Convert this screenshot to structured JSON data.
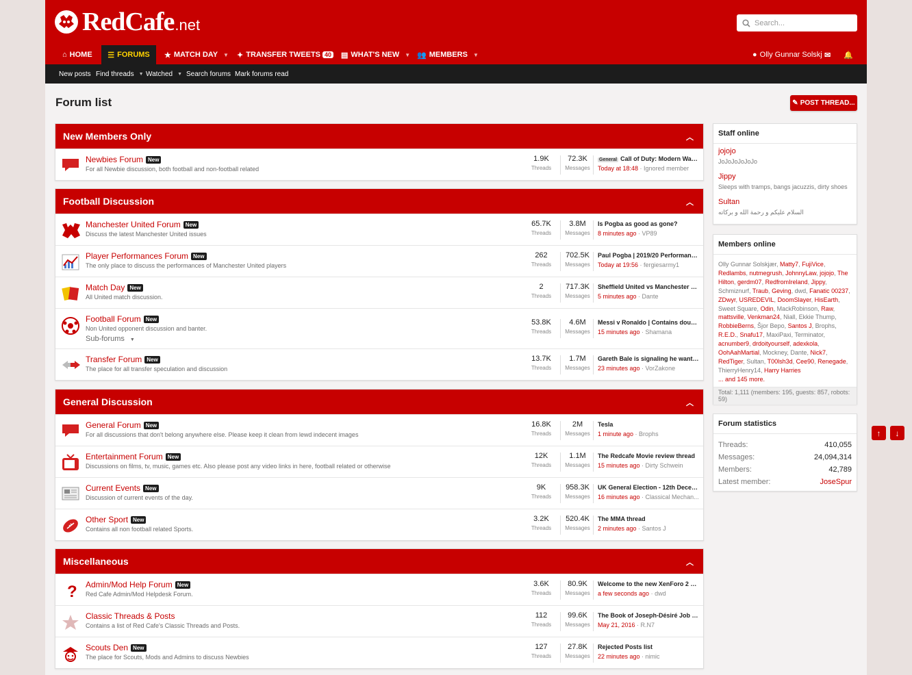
{
  "header": {
    "logo_text": "RedCafe",
    "logo_tld": ".net",
    "search_placeholder": "Search..."
  },
  "nav": {
    "home": "HOME",
    "forums": "FORUMS",
    "match_day": "MATCH DAY",
    "transfer_tweets": "TRANSFER TWEETS",
    "transfer_count": "40",
    "whats_new": "WHAT'S NEW",
    "members": "MEMBERS",
    "user": "Olly Gunnar Solskj"
  },
  "subnav": {
    "new_posts": "New posts",
    "find_threads": "Find threads",
    "watched": "Watched",
    "search_forums": "Search forums",
    "mark_read": "Mark forums read"
  },
  "page": {
    "title": "Forum list",
    "post_thread": "POST THREAD..."
  },
  "labels": {
    "threads": "Threads",
    "messages": "Messages",
    "new": "New",
    "subforums": "Sub-forums"
  },
  "categories": [
    {
      "title": "New Members Only",
      "nodes": [
        {
          "title": "Newbies Forum",
          "new": true,
          "desc": "For all Newbie discussion, both football and non-football related",
          "threads": "1.9K",
          "messages": "72.3K",
          "prefix": "General",
          "last_title": "Call of Duty: Modern Ware...",
          "last_time": "Today at 18:48",
          "last_user": "Ignored member"
        }
      ]
    },
    {
      "title": "Football Discussion",
      "nodes": [
        {
          "title": "Manchester United Forum",
          "new": true,
          "desc": "Discuss the latest Manchester United issues",
          "threads": "65.7K",
          "messages": "3.8M",
          "last_title": "Is Pogba as good as gone?",
          "last_time": "8 minutes ago",
          "last_user": "VP89"
        },
        {
          "title": "Player Performances Forum",
          "new": true,
          "desc": "The only place to discuss the performances of Manchester United players",
          "threads": "262",
          "messages": "702.5K",
          "last_title": "Paul Pogba | 2019/20 Performanc...",
          "last_time": "Today at 19:56",
          "last_user": "fergiesarmy1"
        },
        {
          "title": "Match Day",
          "new": true,
          "desc": "All United match discussion.",
          "threads": "2",
          "messages": "717.3K",
          "last_title": "Sheffield United vs Manchester Un...",
          "last_time": "5 minutes ago",
          "last_user": "Dante"
        },
        {
          "title": "Football Forum",
          "new": true,
          "desc": "Non United opponent discussion and banter.",
          "threads": "53.8K",
          "messages": "4.6M",
          "last_title": "Messi v Ronaldo | Contains double...",
          "last_time": "15 minutes ago",
          "last_user": "Shamana"
        },
        {
          "title": "Transfer Forum",
          "new": true,
          "desc": "The place for all transfer speculation and discussion",
          "threads": "13.7K",
          "messages": "1.7M",
          "last_title": "Gareth Bale is signaling he wants t...",
          "last_time": "23 minutes ago",
          "last_user": "VorZakone"
        }
      ]
    },
    {
      "title": "General Discussion",
      "nodes": [
        {
          "title": "General Forum",
          "new": true,
          "desc": "For all discussions that don't belong anywhere else. Please keep it clean from lewd indecent images",
          "threads": "16.8K",
          "messages": "2M",
          "last_title": "Tesla",
          "last_time": "1 minute ago",
          "last_user": "Brophs"
        },
        {
          "title": "Entertainment Forum",
          "new": true,
          "desc": "Discussions on films, tv, music, games etc. Also please post any video links in here, football related or otherwise",
          "threads": "12K",
          "messages": "1.1M",
          "last_title": "The Redcafe Movie review thread",
          "last_time": "15 minutes ago",
          "last_user": "Dirty Schwein"
        },
        {
          "title": "Current Events",
          "new": true,
          "desc": "Discussion of current events of the day.",
          "threads": "9K",
          "messages": "958.3K",
          "last_title": "UK General Election - 12th Decem...",
          "last_time": "16 minutes ago",
          "last_user": "Classical Mechan..."
        },
        {
          "title": "Other Sport",
          "new": true,
          "desc": "Contains all non football related Sports.",
          "threads": "3.2K",
          "messages": "520.4K",
          "last_title": "The MMA thread",
          "last_time": "2 minutes ago",
          "last_user": "Santos J"
        }
      ]
    },
    {
      "title": "Miscellaneous",
      "nodes": [
        {
          "title": "Admin/Mod Help Forum",
          "new": true,
          "desc": "Red Cafe Admin/Mod Helpdesk Forum.",
          "threads": "3.6K",
          "messages": "80.9K",
          "last_title": "Welcome to the new XenForo 2 sit...",
          "last_time": "a few seconds ago",
          "last_user": "dwd"
        },
        {
          "title": "Classic Threads & Posts",
          "new": false,
          "desc": "Contains a list of Red Cafe's Classic Threads and Posts.",
          "threads": "112",
          "messages": "99.6K",
          "last_title": "The Book of Joseph-Désiré Job (F...",
          "last_time": "May 21, 2016",
          "last_user": "R.N7"
        },
        {
          "title": "Scouts Den",
          "new": true,
          "desc": "The place for Scouts, Mods and Admins to discuss Newbies",
          "threads": "127",
          "messages": "27.8K",
          "last_title": "Rejected Posts list",
          "last_time": "22 minutes ago",
          "last_user": "nimic"
        }
      ]
    }
  ],
  "staff_online": {
    "title": "Staff online",
    "members": [
      {
        "name": "jojojo",
        "status": "JoJoJoJoJoJo"
      },
      {
        "name": "Jippy",
        "status": "Sleeps with tramps, bangs jacuzzis, dirty shoes"
      },
      {
        "name": "Sultan",
        "status": "السلام عليكم و رحمة الله و بركاته"
      }
    ]
  },
  "members_online": {
    "title": "Members online",
    "list": [
      {
        "n": "Olly Gunnar Solskjær",
        "r": false
      },
      {
        "n": "Matty7",
        "r": true
      },
      {
        "n": "FujiVice",
        "r": true
      },
      {
        "n": "Redlambs",
        "r": true
      },
      {
        "n": "nutmegrush",
        "r": true
      },
      {
        "n": "JohnnyLaw",
        "r": true
      },
      {
        "n": "jojojo",
        "r": true
      },
      {
        "n": "The Hilton",
        "r": true
      },
      {
        "n": "gerdm07",
        "r": true
      },
      {
        "n": "RedfromIreland",
        "r": true
      },
      {
        "n": "Jippy",
        "r": true
      },
      {
        "n": "Schmiznurf",
        "r": false
      },
      {
        "n": "Traub",
        "r": true
      },
      {
        "n": "Geving",
        "r": true
      },
      {
        "n": "dwd",
        "r": false
      },
      {
        "n": "Fanatic 00237",
        "r": true
      },
      {
        "n": "ZDwyr",
        "r": true
      },
      {
        "n": "USREDEVIL",
        "r": true
      },
      {
        "n": "DoomSlayer",
        "r": true
      },
      {
        "n": "HisEarth",
        "r": true
      },
      {
        "n": "Sweet Square",
        "r": false
      },
      {
        "n": "Odin",
        "r": true
      },
      {
        "n": "MackRobinson",
        "r": false
      },
      {
        "n": "Raw",
        "r": true
      },
      {
        "n": "mattsville",
        "r": true
      },
      {
        "n": "Venkman24",
        "r": true
      },
      {
        "n": "Niall",
        "r": false
      },
      {
        "n": "Ekkie Thump",
        "r": false
      },
      {
        "n": "RobbieBerns",
        "r": true
      },
      {
        "n": "Šjor Bepo",
        "r": false
      },
      {
        "n": "Santos J",
        "r": true
      },
      {
        "n": "Brophs",
        "r": false
      },
      {
        "n": "R.E.D.",
        "r": true
      },
      {
        "n": "Snafu17",
        "r": true
      },
      {
        "n": "MaxiPaxi",
        "r": false
      },
      {
        "n": "Terminator",
        "r": false
      },
      {
        "n": "acnumber9",
        "r": true
      },
      {
        "n": "drdoityourself",
        "r": true
      },
      {
        "n": "adexkola",
        "r": true
      },
      {
        "n": "OohAahMartial",
        "r": true
      },
      {
        "n": "Mockney",
        "r": false
      },
      {
        "n": "Dante",
        "r": false
      },
      {
        "n": "Nick7",
        "r": true
      },
      {
        "n": "RedTiger",
        "r": true
      },
      {
        "n": "Sultan",
        "r": false
      },
      {
        "n": "T00lsh3d",
        "r": true
      },
      {
        "n": "Cee90",
        "r": true
      },
      {
        "n": "Renegade",
        "r": true
      },
      {
        "n": "ThierryHenry14",
        "r": false
      },
      {
        "n": "Harry Harries",
        "r": true
      }
    ],
    "more": "... and 145 more.",
    "total": "Total: 1,111 (members: 195, guests: 857, robots: 59)"
  },
  "forum_stats": {
    "title": "Forum statistics",
    "rows": [
      {
        "k": "Threads:",
        "v": "410,055"
      },
      {
        "k": "Messages:",
        "v": "24,094,314"
      },
      {
        "k": "Members:",
        "v": "42,789"
      },
      {
        "k": "Latest member:",
        "v": "JoseSpur"
      }
    ]
  },
  "colors": {
    "brand": "#c70000",
    "dark": "#1c1c1c",
    "accent": "#ffd200"
  }
}
